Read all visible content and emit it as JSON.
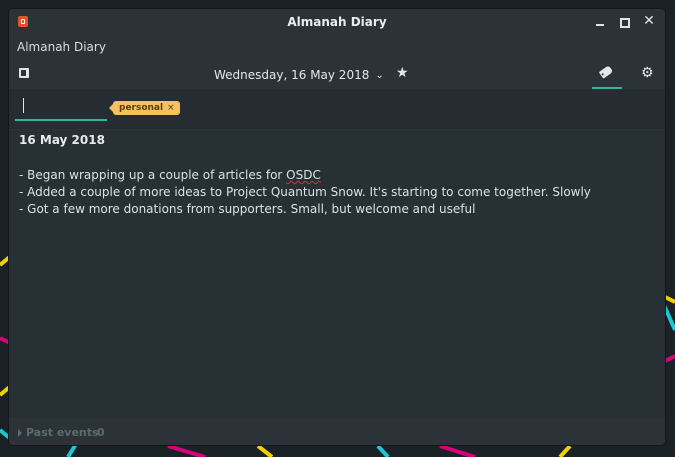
{
  "window": {
    "title": "Almanah Diary"
  },
  "menu": {
    "app_name": "Almanah Diary"
  },
  "toolbar": {
    "date_label": "Wednesday, 16 May 2018",
    "chevron_icon": "chevron-down-icon",
    "star_icon": "star-icon",
    "tags_icon": "tags-icon",
    "settings_icon": "gear-icon",
    "edit_icon": "edit-entry-icon"
  },
  "tags": {
    "input_value": "",
    "chips": [
      {
        "label": "personal",
        "remove": "×"
      }
    ]
  },
  "entry": {
    "date": "16 May 2018",
    "lines": [
      {
        "pre": "- Began wrapping up a couple of articles for ",
        "spell": "OSDC",
        "post": ""
      },
      {
        "pre": "- Added a couple of more ideas to Project Quantum Snow. It's starting to come together. Slowly",
        "spell": "",
        "post": ""
      },
      {
        "pre": "- Got a few more donations from supporters. Small, but welcome and useful",
        "spell": "",
        "post": ""
      }
    ]
  },
  "past_events": {
    "label": "Past events",
    "count": "0"
  },
  "colors": {
    "accent": "#2fb79b",
    "tag_chip": "#f5c060",
    "window_bg": "#2b3339",
    "editor_bg": "#263035"
  }
}
